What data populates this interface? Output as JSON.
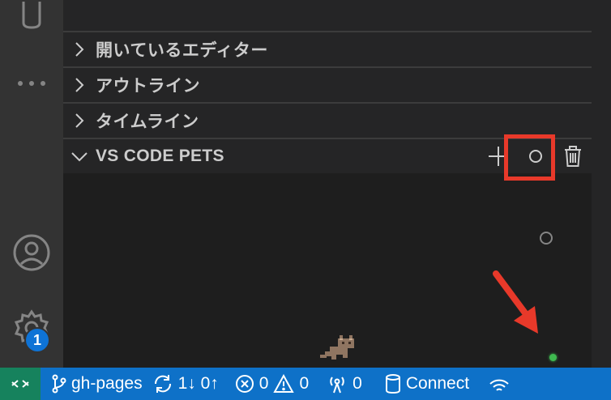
{
  "sidebar": {
    "sections": [
      {
        "title": "開いているエディター",
        "expanded": false
      },
      {
        "title": "アウトライン",
        "expanded": false
      },
      {
        "title": "タイムライン",
        "expanded": false
      },
      {
        "title": "VS CODE PETS",
        "expanded": true
      }
    ],
    "pets_actions": [
      {
        "icon": "plus-icon",
        "name": "add-pet"
      },
      {
        "icon": "ball-icon",
        "name": "throw-ball"
      },
      {
        "icon": "trash-icon",
        "name": "delete-pet"
      }
    ]
  },
  "activity_bar": {
    "settings_badge": "1"
  },
  "status_bar": {
    "branch": "gh-pages",
    "sync": "1↓ 0↑",
    "errors": "0",
    "warnings": "0",
    "ports": "0",
    "connect": "Connect"
  },
  "colors": {
    "status_bar": "#0e71c8",
    "remote": "#16825d",
    "highlight": "#e8392a",
    "badge": "#0e73d6"
  }
}
